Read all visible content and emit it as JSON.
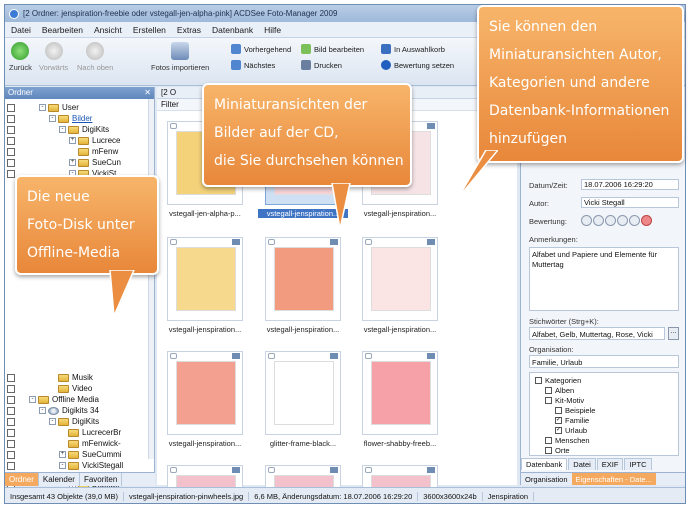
{
  "window": {
    "title": "[2 Ordner: jenspiration-freebie oder vstegall-jen-alpha-pink] ACDSee Foto-Manager 2009"
  },
  "menu": [
    "Datei",
    "Bearbeiten",
    "Ansicht",
    "Erstellen",
    "Extras",
    "Datenbank",
    "Hilfe"
  ],
  "toolbar": {
    "back": "Zurück",
    "forward": "Vorwärts",
    "up": "Nach oben",
    "import": "Fotos importieren",
    "prev": "Vorhergehend",
    "next": "Nächstes",
    "edit": "Bild bearbeiten",
    "print": "Drucken",
    "basket": "In Auswahlkorb",
    "rating": "Bewertung setzen"
  },
  "left_panel": {
    "title": "Ordner",
    "tree": [
      {
        "label": "User",
        "level": 2,
        "type": "folder",
        "sign": "-"
      },
      {
        "label": "Bilder",
        "level": 3,
        "type": "folder",
        "sign": "-",
        "selected": true
      },
      {
        "label": "DigiKits",
        "level": 4,
        "type": "folder",
        "sign": "-"
      },
      {
        "label": "Lucrece",
        "level": 5,
        "type": "folder",
        "sign": "+"
      },
      {
        "label": "mFenw",
        "level": 5,
        "type": "folder",
        "sign": ""
      },
      {
        "label": "SueCun",
        "level": 5,
        "type": "folder",
        "sign": "+"
      },
      {
        "label": "VickiSt",
        "level": 5,
        "type": "folder",
        "sign": "-"
      },
      {
        "label": "Musik",
        "level": 3,
        "type": "folder",
        "sign": ""
      },
      {
        "label": "Video",
        "level": 3,
        "type": "folder",
        "sign": ""
      },
      {
        "label": "Offline Media",
        "level": 1,
        "type": "folder",
        "sign": "-"
      },
      {
        "label": "Digikits 34",
        "level": 2,
        "type": "cd",
        "sign": "-"
      },
      {
        "label": "DigiKits",
        "level": 3,
        "type": "folder",
        "sign": "-"
      },
      {
        "label": "LucrecerBr",
        "level": 4,
        "type": "folder",
        "sign": ""
      },
      {
        "label": "mFenwick-",
        "level": 4,
        "type": "folder",
        "sign": ""
      },
      {
        "label": "SueCummi",
        "level": 4,
        "type": "folder",
        "sign": "+"
      },
      {
        "label": "VickiStegall",
        "level": 4,
        "type": "folder",
        "sign": "-"
      },
      {
        "label": "1VickiS",
        "level": 5,
        "type": "folder",
        "sign": ""
      },
      {
        "label": "Bohemi",
        "level": 5,
        "type": "folder",
        "sign": "+"
      },
      {
        "label": "jenspira",
        "level": 5,
        "type": "folder",
        "sign": "-"
      },
      {
        "label": "vste",
        "level": 6,
        "type": "folder",
        "sign": ""
      },
      {
        "label": "Retrokit",
        "level": 4,
        "type": "folder",
        "sign": "+"
      }
    ],
    "tabs": [
      "Ordner",
      "Kalender",
      "Favoriten"
    ],
    "active_tab": "Ordner"
  },
  "center": {
    "path": "[2 O",
    "filter": "Filter",
    "thumbnails": [
      {
        "caption": "vstegall-jen-alpha-p...",
        "color": "#f3d27a",
        "selected": false
      },
      {
        "caption": "vstegall-jenspiration...",
        "color": "#f6d4d9",
        "selected": true
      },
      {
        "caption": "vstegall-jenspiration...",
        "color": "#f6e3e6",
        "selected": false
      },
      {
        "caption": "vstegall-jenspiration...",
        "color": "#f6d98c",
        "selected": false
      },
      {
        "caption": "vstegall-jenspiration...",
        "color": "#f39b7f",
        "selected": false
      },
      {
        "caption": "vstegall-jenspiration...",
        "color": "#fbe4e4",
        "selected": false
      },
      {
        "caption": "vstegall-jenspiration...",
        "color": "#f4a090",
        "selected": false
      },
      {
        "caption": "glitter-frame-black...",
        "color": "#ffffff",
        "selected": false
      },
      {
        "caption": "flower-shabby-freeb...",
        "color": "#f6a1a8",
        "selected": false
      },
      {
        "caption": "",
        "color": "#f3c1cb",
        "selected": false
      },
      {
        "caption": "",
        "color": "#f3c1cb",
        "selected": false
      },
      {
        "caption": "",
        "color": "#f3c1cb",
        "selected": false
      }
    ]
  },
  "properties": {
    "date_label": "Datum/Zeit:",
    "date_value": "18.07.2006 16:29:20",
    "author_label": "Autor:",
    "author_value": "Vicki Stegall",
    "rating_label": "Bewertung:",
    "notes_label": "Anmerkungen:",
    "notes_value": "Alfabet und Papiere und Elemente für Muttertag",
    "keywords_label": "Stichwörter (Strg+K):",
    "keywords_value": "Alfabet, Gelb, Muttertag, Rose, Vicki",
    "org_label": "Organisation:",
    "org_value": "Familie, Urlaub",
    "categories": [
      {
        "label": "Kategorien",
        "indent": 0,
        "check": ""
      },
      {
        "label": "Alben",
        "indent": 1,
        "check": ""
      },
      {
        "label": "Kit-Motiv",
        "indent": 1,
        "check": ""
      },
      {
        "label": "Beispiele",
        "indent": 2,
        "check": ""
      },
      {
        "label": "Familie",
        "indent": 2,
        "check": "✓"
      },
      {
        "label": "Urlaub",
        "indent": 2,
        "check": "✓"
      },
      {
        "label": "Menschen",
        "indent": 1,
        "check": ""
      },
      {
        "label": "Orte",
        "indent": 1,
        "check": ""
      }
    ],
    "tabs": [
      "Datenbank",
      "Datei",
      "EXIF",
      "IPTC"
    ],
    "bottom_tabs": [
      "Organisation",
      "Eigenschaften - Date..."
    ]
  },
  "status": {
    "total": "Insgesamt 43 Objekte (39,0 MB)",
    "file": "vstegall-jenspiration-pinwheels.jpg",
    "info": "6,6 MB, Änderungsdatum: 18.07.2006 16:29:20",
    "dims": "3600x3600x24b",
    "folder": "Jenspiration"
  },
  "callouts": {
    "top_right": [
      "Sie können den",
      "Miniaturansichten Autor,",
      "Kategorien und andere",
      "Datenbank-Informationen",
      "hinzufügen"
    ],
    "center": [
      "Miniaturansichten der",
      "Bilder auf der CD,",
      "die Sie durchsehen können"
    ],
    "left": [
      "Die neue",
      "Foto-Disk unter",
      "Offline-Media"
    ]
  },
  "colors": {
    "callout": "#f0994a",
    "accent": "#3f74c5"
  }
}
